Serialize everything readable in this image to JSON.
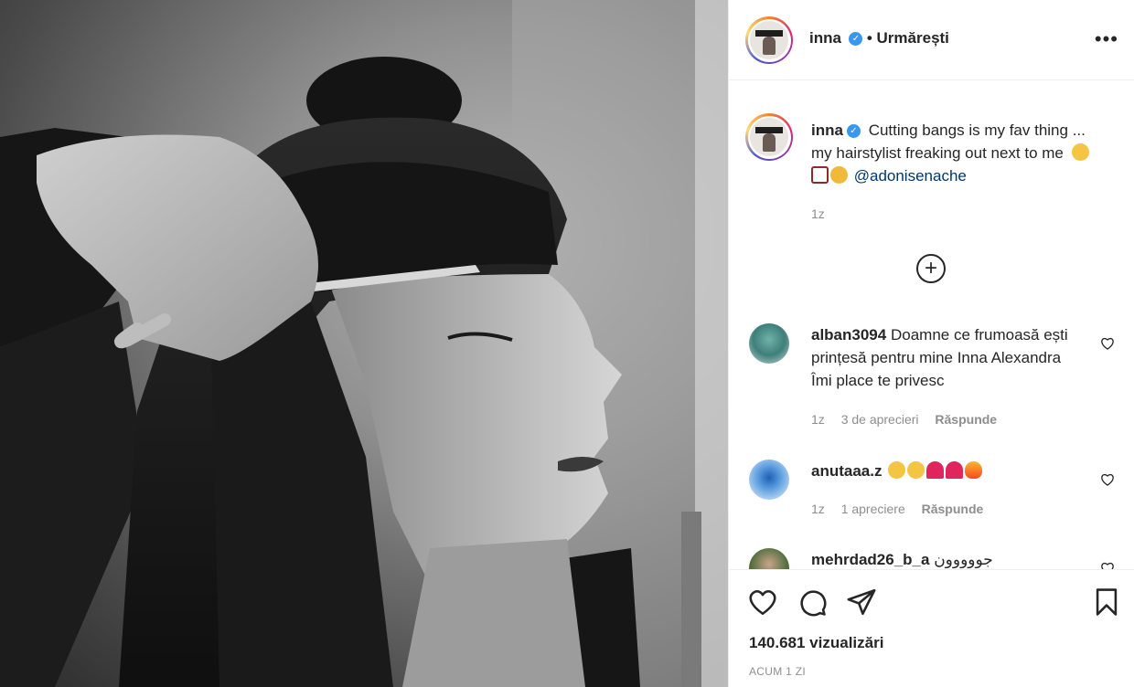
{
  "post": {
    "username": "inna",
    "follow_status": "• Urmărești",
    "more_icon": "more-horizontal-icon"
  },
  "caption": {
    "username": "inna",
    "text": "Cutting bangs is my fav thing ... my hairstylist freaking out next to me",
    "emojis": [
      "astonished-face",
      "scissors",
      "zany-face"
    ],
    "mention": "@adonisenache",
    "time": "1z"
  },
  "comments": [
    {
      "username": "alban3094",
      "text": "Doamne ce frumoasă ești prințesă pentru mine Inna Alexandra Îmi place te privesc",
      "time": "1z",
      "likes": "3 de aprecieri",
      "reply": "Răspunde"
    },
    {
      "username": "anutaaa.z",
      "text": "",
      "emojis": [
        "heart-eyes",
        "heart-eyes",
        "red-heart",
        "red-heart",
        "fire"
      ],
      "time": "1z",
      "likes": "1 apreciere",
      "reply": "Răspunde"
    },
    {
      "username": "mehrdad26_b_a",
      "text": "جووووون"
    }
  ],
  "footer": {
    "views": "140.681 vizualizări",
    "ago": "ACUM 1 ZI"
  },
  "colors": {
    "verified": "#3897f0",
    "mention": "#00376b",
    "muted": "#8e8e8e"
  }
}
